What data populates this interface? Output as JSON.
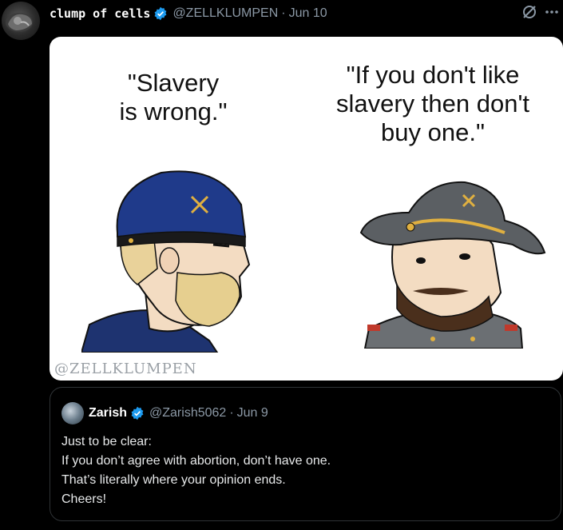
{
  "tweet": {
    "display_name": "clump of cells",
    "handle": "@ZELLKLUMPEN",
    "separator": "·",
    "date": "Jun 10",
    "more_icon": "ellipsis-icon",
    "grok_icon": "grok-icon"
  },
  "media": {
    "left_caption_line1": "\"Slavery",
    "left_caption_line2": "is wrong.\"",
    "right_caption_line1": "\"If you don't like",
    "right_caption_line2": "slavery then don't",
    "right_caption_line3": "buy one.\"",
    "watermark": "@ZELLKLUMPEN"
  },
  "quoted_tweet": {
    "display_name": "Zarish",
    "handle": "@Zarish5062",
    "separator": "·",
    "date": "Jun 9",
    "lines": [
      "Just to be clear:",
      "If you don’t agree with abortion, don’t have one.",
      "That’s literally where your opinion ends.",
      "Cheers!"
    ]
  },
  "colors": {
    "background": "#000000",
    "verified_blue": "#1d9bf0",
    "muted_text": "#8b98a5",
    "union_blue": "#1f3a8a",
    "confederate_gray": "#5b5f63"
  }
}
